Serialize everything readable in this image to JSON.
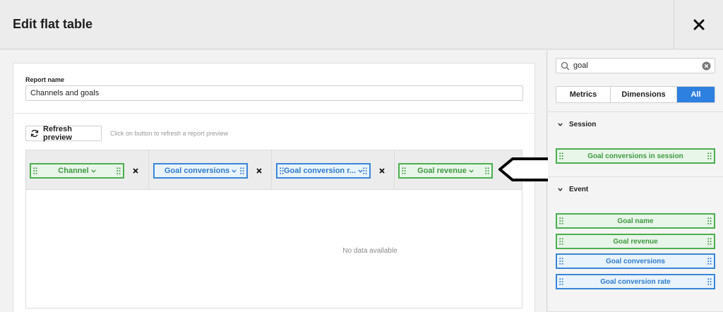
{
  "header": {
    "title": "Edit flat table",
    "close_icon": "close-icon"
  },
  "form": {
    "report_name_label": "Report name",
    "report_name_value": "Channels and goals"
  },
  "preview": {
    "refresh_label": "Refresh preview",
    "refresh_icon": "refresh-icon",
    "hint": "Click on button to refresh a report preview",
    "no_data": "No data available"
  },
  "columns": [
    {
      "label": "Channel",
      "type": "dimension",
      "color": "#4caf50"
    },
    {
      "label": "Goal conversions",
      "type": "metric",
      "color": "#3a86d8"
    },
    {
      "label": "Goal conversion r...",
      "type": "metric",
      "color": "#3a86d8"
    },
    {
      "label": "Goal revenue",
      "type": "dimension",
      "color": "#4caf50"
    }
  ],
  "sidebar": {
    "search_value": "goal",
    "search_icon": "search-icon",
    "clear_icon": "clear-icon",
    "tabs": [
      {
        "label": "Metrics",
        "active": false
      },
      {
        "label": "Dimensions",
        "active": false
      },
      {
        "label": "All",
        "active": true
      }
    ],
    "sections": [
      {
        "title": "Session",
        "items": [
          {
            "label": "Goal conversions in session",
            "type": "dimension"
          }
        ]
      },
      {
        "title": "Event",
        "items": [
          {
            "label": "Goal name",
            "type": "dimension"
          },
          {
            "label": "Goal revenue",
            "type": "dimension"
          },
          {
            "label": "Goal conversions",
            "type": "metric"
          },
          {
            "label": "Goal conversion rate",
            "type": "metric"
          }
        ]
      }
    ]
  },
  "colors": {
    "dimension": "#4caf50",
    "metric": "#3a86d8",
    "accent": "#2d7fe0"
  }
}
